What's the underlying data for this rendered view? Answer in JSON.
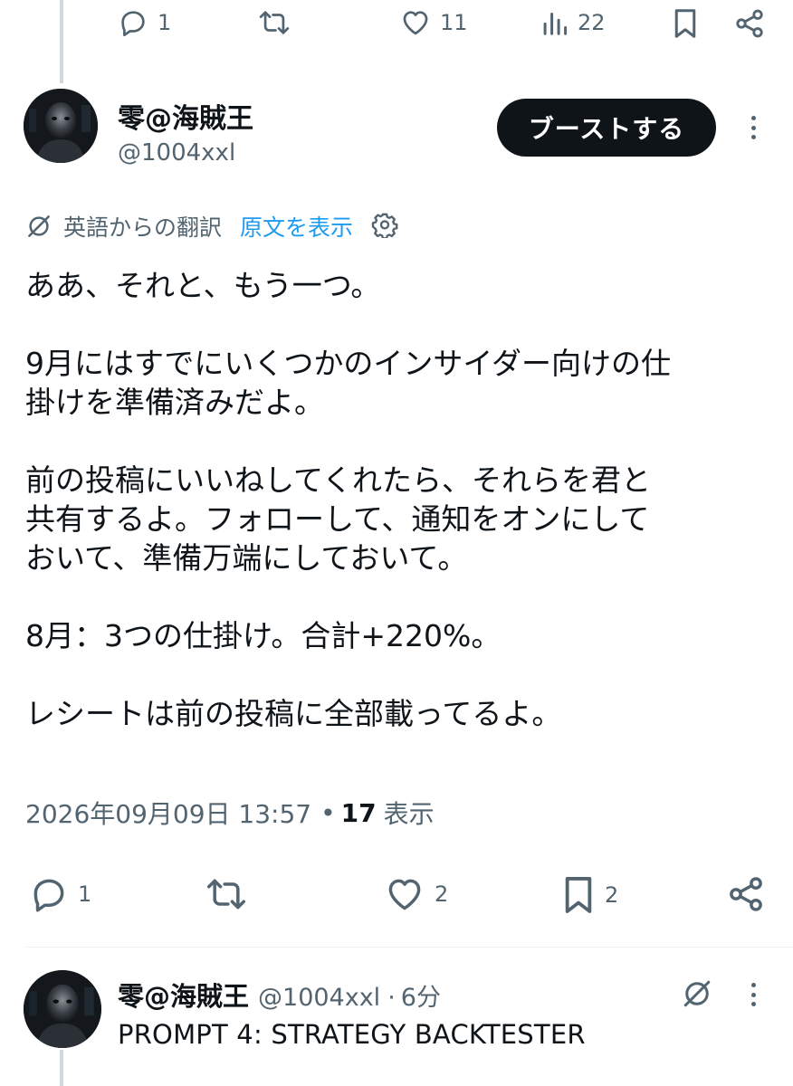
{
  "prev_post_actions": {
    "reply_count": "1",
    "repost_count": "",
    "like_count": "11",
    "views_count": "22",
    "bookmark_count": "",
    "share_count": ""
  },
  "post": {
    "author_name": "零@海賊王",
    "author_handle": "@1004xxl",
    "boost_label": "ブーストする",
    "translation_label": "英語からの翻訳",
    "show_original_label": "原文を表示",
    "paragraphs": [
      "ああ、それと、もう一つ。",
      "9月にはすでにいくつかのインサイダー向けの仕\n掛けを準備済みだよ。",
      "前の投稿にいいねしてくれたら、それらを君と\n共有するよ。フォローして、通知をオンにして\nおいて、準備万端にしておいて。",
      "8月：3つの仕掛け。合計+220%。",
      "レシートは前の投稿に全部載ってるよ。"
    ],
    "timestamp": "2026年09月09日 13:57",
    "separator": "•",
    "views_num": "17",
    "views_label": "表示",
    "actions": {
      "reply_count": "1",
      "repost_count": "",
      "like_count": "2",
      "bookmark_count": "2"
    }
  },
  "reply": {
    "author_name": "零@海賊王",
    "author_handle": "@1004xxl",
    "separator": "·",
    "time_ago": "6分",
    "text": "PROMPT 4: STRATEGY BACKTESTER"
  },
  "icons": {
    "reply": "speech-bubble-icon",
    "repost": "repost-arrows-icon",
    "like": "heart-icon",
    "views": "bar-chart-icon",
    "bookmark": "bookmark-icon",
    "share": "share-icon",
    "translate": "translate-slash-icon",
    "settings": "gear-icon",
    "more": "more-dots-icon"
  },
  "colors": {
    "text": "#0f1419",
    "secondary": "#536471",
    "link": "#1d9bf0",
    "button_bg": "#0f1419"
  }
}
